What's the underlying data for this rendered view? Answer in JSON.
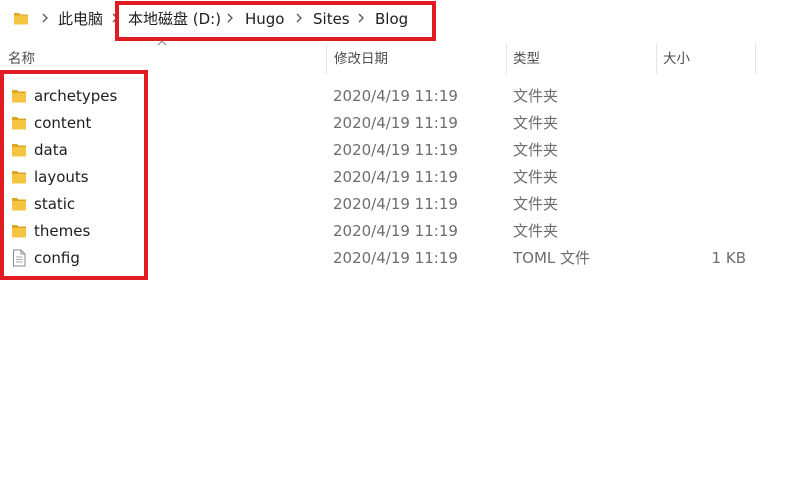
{
  "address_bar": {
    "crumbs": [
      "此电脑",
      "本地磁盘 (D:)",
      "Hugo",
      "Sites",
      "Blog"
    ]
  },
  "columns": {
    "name": "名称",
    "date": "修改日期",
    "type": "类型",
    "size": "大小"
  },
  "files": [
    {
      "name": "archetypes",
      "date": "2020/4/19 11:19",
      "type": "文件夹",
      "size": "",
      "icon": "folder-icon"
    },
    {
      "name": "content",
      "date": "2020/4/19 11:19",
      "type": "文件夹",
      "size": "",
      "icon": "folder-icon"
    },
    {
      "name": "data",
      "date": "2020/4/19 11:19",
      "type": "文件夹",
      "size": "",
      "icon": "folder-icon"
    },
    {
      "name": "layouts",
      "date": "2020/4/19 11:19",
      "type": "文件夹",
      "size": "",
      "icon": "folder-icon"
    },
    {
      "name": "static",
      "date": "2020/4/19 11:19",
      "type": "文件夹",
      "size": "",
      "icon": "folder-icon"
    },
    {
      "name": "themes",
      "date": "2020/4/19 11:19",
      "type": "文件夹",
      "size": "",
      "icon": "folder-icon"
    },
    {
      "name": "config",
      "date": "2020/4/19 11:19",
      "type": "TOML 文件",
      "size": "1 KB",
      "icon": "file-icon"
    }
  ],
  "colors": {
    "highlight": "#e01b24",
    "folder": "#f5c542",
    "folder_dark": "#dba723"
  }
}
